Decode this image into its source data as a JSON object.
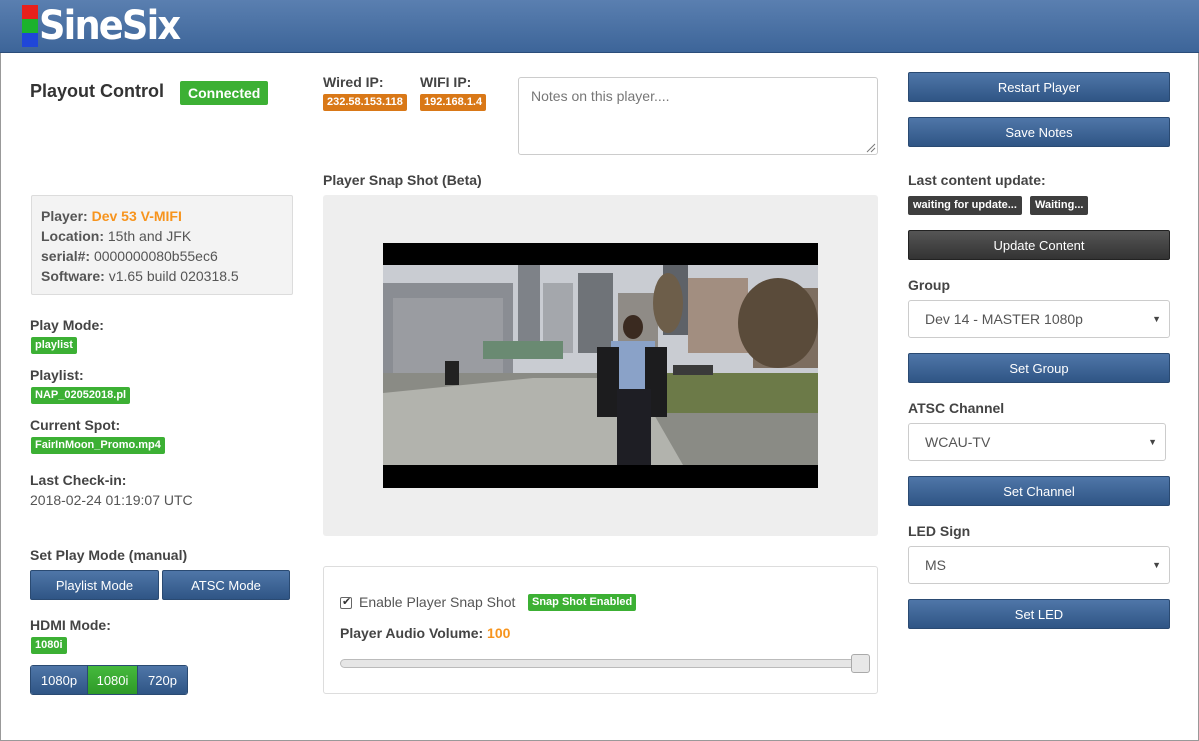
{
  "brand": {
    "name": "SineSix"
  },
  "header": {
    "title": "Playout Control",
    "status": "Connected"
  },
  "network": {
    "wired_label": "Wired IP:",
    "wired_ip": "232.58.153.118",
    "wifi_label": "WIFI IP:",
    "wifi_ip": "192.168.1.4"
  },
  "notes": {
    "placeholder": "Notes on this player...."
  },
  "player_info": {
    "player_label": "Player:",
    "player_value": "Dev 53 V-MIFI",
    "location_label": "Location:",
    "location_value": "15th and JFK",
    "serial_label": "serial#:",
    "serial_value": "0000000080b55ec6",
    "software_label": "Software:",
    "software_value": "v1.65 build 020318.5"
  },
  "status": {
    "play_mode_label": "Play Mode:",
    "play_mode": "playlist",
    "playlist_label": "Playlist:",
    "playlist": "NAP_02052018.pl",
    "current_spot_label": "Current Spot:",
    "current_spot": "FairInMoon_Promo.mp4",
    "last_checkin_label": "Last Check-in:",
    "last_checkin": "2018-02-24 01:19:07 UTC"
  },
  "manual_mode": {
    "label": "Set Play Mode (manual)",
    "playlist_btn": "Playlist Mode",
    "atsc_btn": "ATSC Mode"
  },
  "hdmi": {
    "label": "HDMI Mode:",
    "current": "1080i",
    "options": [
      "1080p",
      "1080i",
      "720p"
    ]
  },
  "snapshot": {
    "title": "Player Snap Shot (Beta)"
  },
  "snapshot_settings": {
    "enable_label": "Enable Player Snap Shot",
    "enabled_badge": "Snap Shot Enabled",
    "volume_label": "Player Audio Volume:",
    "volume_value": "100"
  },
  "right": {
    "restart_btn": "Restart Player",
    "save_notes_btn": "Save Notes",
    "last_update_label": "Last content update:",
    "update_badge_1": "waiting for update...",
    "update_badge_2": "Waiting...",
    "update_content_btn": "Update Content",
    "group_label": "Group",
    "group_value": "Dev 14 - MASTER 1080p",
    "set_group_btn": "Set Group",
    "atsc_label": "ATSC Channel",
    "atsc_value": "WCAU-TV",
    "set_channel_btn": "Set Channel",
    "led_label": "LED Sign",
    "led_value": "MS",
    "set_led_btn": "Set LED"
  },
  "colors": {
    "brand_blue": "#3d6599",
    "accent_green": "#3cb034",
    "accent_orange": "#d97817"
  }
}
